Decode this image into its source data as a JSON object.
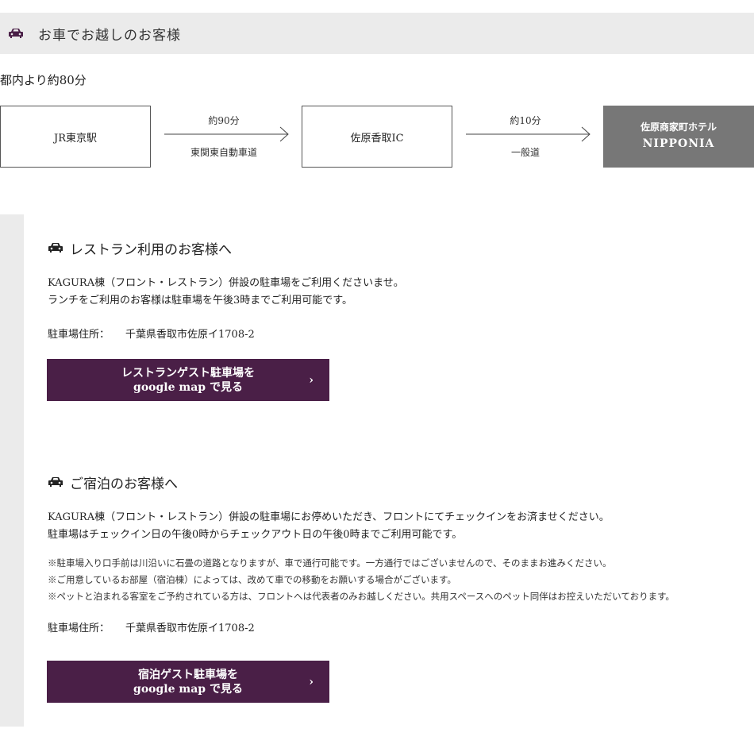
{
  "header": {
    "title": "お車でお越しのお客様",
    "icon": "car-icon"
  },
  "sub_note": "都内より約80分",
  "route": {
    "stations": [
      "JR東京駅",
      "佐原香取IC"
    ],
    "destination": {
      "line1": "佐原商家町ホテル",
      "line2": "NIPPONIA"
    },
    "legs": [
      {
        "time": "約90分",
        "road": "東関東自動車道"
      },
      {
        "time": "約10分",
        "road": "一般道"
      }
    ]
  },
  "restaurant": {
    "heading": "レストラン利用のお客様へ",
    "lines": [
      "KAGURA棟（フロント・レストラン）併設の駐車場をご利用くださいませ。",
      "ランチをご利用のお客様は駐車場を午後3時までご利用可能です。"
    ],
    "address_label": "駐車場住所：",
    "address": "千葉県香取市佐原イ1708-2",
    "button_line1": "レストランゲスト駐車場を",
    "button_line2": "google map で見る",
    "button_chevron": "›"
  },
  "lodging": {
    "heading": "ご宿泊のお客様へ",
    "lines": [
      "KAGURA棟（フロント・レストラン）併設の駐車場にお停めいただき、フロントにてチェックインをお済ませください。",
      "駐車場はチェックイン日の午後0時からチェックアウト日の午後0時までご利用可能です。"
    ],
    "notes": [
      "※駐車場入り口手前は川沿いに石畳の道路となりますが、車で通行可能です。一方通行ではございませんので、そのままお進みください。",
      "※ご用意しているお部屋（宿泊棟）によっては、改めて車での移動をお願いする場合がございます。",
      "※ペットと泊まれる客室をご予約されている方は、フロントへは代表者のみお越しください。共用スペースへのペット同伴はお控えいただいております。"
    ],
    "address_label": "駐車場住所：",
    "address": "千葉県香取市佐原イ1708-2",
    "button_line1": "宿泊ゲスト駐車場を",
    "button_line2": "google map で見る",
    "button_chevron": "›"
  },
  "colors": {
    "accent": "#4a1f47",
    "header_bg": "#ebebeb",
    "destination_bg": "#777777"
  }
}
